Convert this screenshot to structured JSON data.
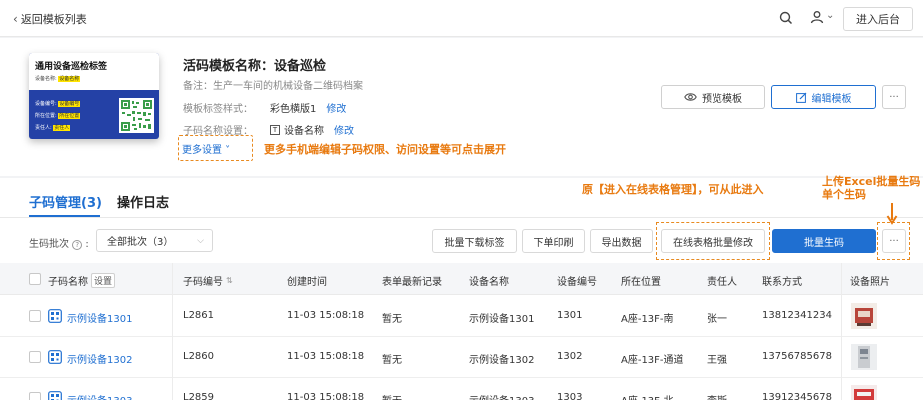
{
  "topbar": {
    "back_label": "返回模板列表",
    "admin_button": "进入后台",
    "user_caret": "⌄"
  },
  "card": {
    "title": "通用设备巡检标签",
    "line1_label": "设备名称:",
    "line1_value": "设备名称",
    "line2_label": "设备编号:",
    "line2_value": "设备编号",
    "line3_label": "所在位置:",
    "line3_value": "所在位置",
    "line4_label": "责任人:",
    "line4_value": "责任人"
  },
  "template": {
    "title": "活码模板名称：设备巡检",
    "note": "备注：生产一车间的机械设备二维码档案",
    "style_label": "模板标签样式：",
    "style_value": "彩色横版1",
    "style_edit": "修改",
    "name_label": "子码名称设置：",
    "name_icon_text": "T",
    "name_value": "设备名称",
    "name_edit": "修改",
    "more_settings": "更多设置 ˅"
  },
  "annotations": {
    "more_hint": "更多手机端编辑子码权限、访问设置等可点击展开",
    "online_hint": "原【进入在线表格管理】，可从此进入",
    "upload_hint_line1": "上传Excel批量生码",
    "upload_hint_line2": "单个生码"
  },
  "actions": {
    "preview": "预览模板",
    "edit": "编辑模板",
    "more": "···"
  },
  "tabs": [
    {
      "label": "子码管理(3)"
    },
    {
      "label": "操作日志"
    }
  ],
  "filter": {
    "batch_label": "生码批次",
    "batch_value": "全部批次（3）",
    "help_icon": "?"
  },
  "toolbar": {
    "download_labels": "批量下载标签",
    "print": "下单印刷",
    "export": "导出数据",
    "online_edit": "在线表格批量修改",
    "batch_generate": "批量生码",
    "more": "···"
  },
  "table": {
    "columns": [
      "子码名称",
      "子码编号",
      "创建时间",
      "表单最新记录",
      "设备名称",
      "设备编号",
      "所在位置",
      "责任人",
      "联系方式",
      "设备照片"
    ],
    "settings_tag": "设置",
    "sort_icon": "⇅",
    "rows": [
      {
        "name": "示例设备1301",
        "code": "L2861",
        "created": "11-03 15:08:18",
        "latest": "暂无",
        "device_name": "示例设备1301",
        "device_no": "1301",
        "location": "A座-13F-南",
        "owner": "张一",
        "phone": "13812341234"
      },
      {
        "name": "示例设备1302",
        "code": "L2860",
        "created": "11-03 15:08:18",
        "latest": "暂无",
        "device_name": "示例设备1302",
        "device_no": "1302",
        "location": "A座-13F-通道",
        "owner": "王强",
        "phone": "13756785678"
      },
      {
        "name": "示例设备1303",
        "code": "L2859",
        "created": "11-03 15:08:18",
        "latest": "暂无",
        "device_name": "示例设备1303",
        "device_no": "1303",
        "location": "A座-13F-北",
        "owner": "李斯",
        "phone": "13912345678"
      }
    ]
  },
  "colors": {
    "primary": "#1f6fd1",
    "annotation": "#e87a10",
    "card_blue": "#2441a6"
  }
}
